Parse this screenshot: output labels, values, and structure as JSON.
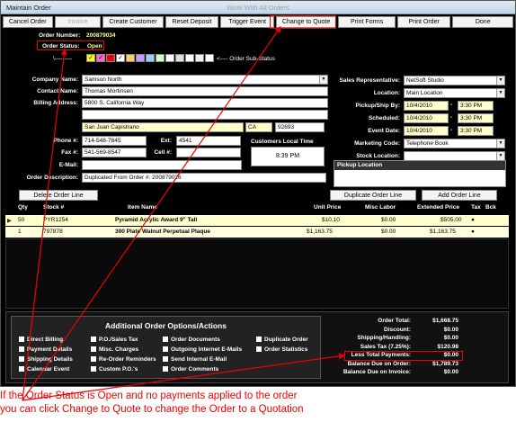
{
  "window": {
    "title": "Maintain Order",
    "center_title": "Work With All Orders"
  },
  "toolbar": [
    "Cancel Order",
    "Invoice",
    "Create Customer",
    "Reset Deposit",
    "Trigger Event",
    "Change to Quote",
    "Print Forms",
    "Print Order",
    "Done"
  ],
  "order": {
    "number_label": "Order Number:",
    "number": "200879034",
    "status_label": "Order Status:",
    "status": "Open",
    "substatus_prefix": "\\---------",
    "substatus_label": "<---- Order Sub-Status"
  },
  "substatus_colors": [
    "#ffff00",
    "#ff66cc",
    "#ff0000",
    "#ffffff",
    "#ffcc66",
    "#cc99ff",
    "#99ccff",
    "#ccffcc",
    "#ffffff",
    "#dddddd",
    "#ffffff",
    "#eeeeee",
    "#ffffff"
  ],
  "customer": {
    "company_label": "Company Name:",
    "company": "Samson North",
    "contact_label": "Contact Name:",
    "contact": "Thomas Mortinsen",
    "billing_label": "Billing Address:",
    "address1": "5800 S. California Way",
    "address2": "",
    "city": "San Juan Capistrano",
    "state": "CA",
    "zip": "92693",
    "phone_label": "Phone #:",
    "phone": "714-548-7845",
    "ext_label": "Ext:",
    "ext": "4541",
    "fax_label": "Fax #:",
    "fax": "541-569-8547",
    "cell_label": "Cell #:",
    "cell": "",
    "email_label": "E-Mail:",
    "email": "",
    "local_time_label": "Customers Local Time",
    "local_time": "8:39 PM",
    "desc_label": "Order Description:",
    "desc": "Duplicated From Order #: 200879026"
  },
  "right": {
    "rep_label": "Sales Representative:",
    "rep": "NetSoft Studio",
    "loc_label": "Location:",
    "loc": "Main Location",
    "pickup_label": "Pickup/Ship By:",
    "pickup_date": "10/4/2010",
    "pickup_time": "3:30 PM",
    "sched_label": "Scheduled:",
    "sched_date": "10/4/2010",
    "sched_time": "3:30 PM",
    "event_label": "Event Date:",
    "event_date": "10/4/2010",
    "event_time": "3:30 PM",
    "mkt_label": "Marketing Code:",
    "mkt": "Telephone Book",
    "stock_label": "Stock Location:",
    "stock": "",
    "pickup_loc_label": "Pickup Location"
  },
  "lines": {
    "delete": "Delete Order Line",
    "duplicate": "Duplicate Order Line",
    "add": "Add Order Line",
    "headers": [
      "Qty",
      "Stock #",
      "Item Name",
      "Unit Price",
      "Misc Labor",
      "Extended Price",
      "Tax",
      "Bck"
    ],
    "rows": [
      {
        "qty": "50",
        "stock": "PYR1254",
        "item": "Pyramid Acrylic Award 9\" Tall",
        "price": "$10.10",
        "labor": "$0.00",
        "ext": "$505.00",
        "tax": "●"
      },
      {
        "qty": "1",
        "stock": "797878",
        "item": "300 Plate Walnut Perpetual Plaque",
        "price": "$1,163.75",
        "labor": "$0.00",
        "ext": "$1,163.75",
        "tax": "●"
      }
    ]
  },
  "options": {
    "title": "Additional Order Options/Actions",
    "items": [
      "Direct Billing",
      "Payment Details",
      "Shipping Details",
      "Calendar Event",
      "P.O./Sales Tax",
      "Misc. Charges",
      "Re-Order Reminders",
      "Custom P.O.'s",
      "Order Documents",
      "Outgoing Internet E-Mails",
      "Send Internal E-Mail",
      "Order Comments",
      "Duplicate Order",
      "Order Statistics"
    ]
  },
  "totals": [
    {
      "label": "Order Total:",
      "value": "$1,668.75"
    },
    {
      "label": "Discount:",
      "value": "$0.00"
    },
    {
      "label": "Shipping/Handling:",
      "value": "$0.00"
    },
    {
      "label": "Sales Tax (7.25%):",
      "value": "$120.98"
    },
    {
      "label": "Less Total Payments:",
      "value": "$0.00"
    },
    {
      "label": "Balance Due on Order:",
      "value": "$1,789.73"
    },
    {
      "label": "Balance Due on Invoice:",
      "value": "$0.00"
    }
  ],
  "caption": [
    "If the Order Status is Open and no payments applied to the order",
    "you can click Change to Quote to change the Order to a Quotation"
  ]
}
